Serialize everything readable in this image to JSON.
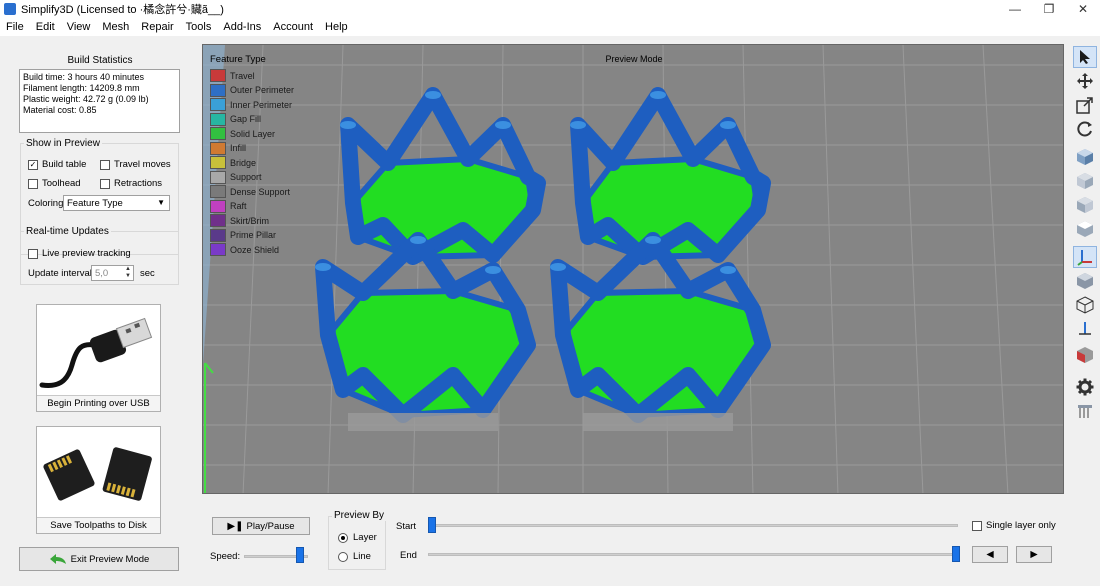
{
  "window": {
    "title": "Simplify3D (Licensed to ·橘念許兮·贜ã__)",
    "minimize": "—",
    "maximize": "❐",
    "close": "✕"
  },
  "menu": [
    "File",
    "Edit",
    "View",
    "Mesh",
    "Repair",
    "Tools",
    "Add-Ins",
    "Account",
    "Help"
  ],
  "left": {
    "stats_title": "Build Statistics",
    "stats": [
      "Build time: 3 hours 40 minutes",
      "Filament length: 14209.8 mm",
      "Plastic weight: 42.72 g (0.09 lb)",
      "Material cost: 0.85"
    ],
    "show_title": "Show in Preview",
    "build_table": "Build table",
    "travel_moves": "Travel moves",
    "toolhead": "Toolhead",
    "retractions": "Retractions",
    "coloring_label": "Coloring",
    "coloring_value": "Feature Type",
    "rt_title": "Real-time Updates",
    "live_preview": "Live preview tracking",
    "update_interval": "Update interval",
    "interval_value": "5,0",
    "sec": "sec",
    "usb_caption": "Begin Printing over USB",
    "disk_caption": "Save Toolpaths to Disk",
    "exit_label": "Exit Preview Mode"
  },
  "viewport": {
    "mode": "Preview Mode",
    "legend_title": "Feature Type",
    "legend": [
      {
        "name": "Travel",
        "color": "#c83a3a"
      },
      {
        "name": "Outer Perimeter",
        "color": "#2f6fc4"
      },
      {
        "name": "Inner Perimeter",
        "color": "#3aa0d8"
      },
      {
        "name": "Gap Fill",
        "color": "#27b6a2"
      },
      {
        "name": "Solid Layer",
        "color": "#32c040"
      },
      {
        "name": "Infill",
        "color": "#d07a32"
      },
      {
        "name": "Bridge",
        "color": "#c8c03a"
      },
      {
        "name": "Support",
        "color": "#a8a8a8"
      },
      {
        "name": "Dense Support",
        "color": "#7a7a7a"
      },
      {
        "name": "Raft",
        "color": "#c040c0"
      },
      {
        "name": "Skirt/Brim",
        "color": "#70308a"
      },
      {
        "name": "Prime Pillar",
        "color": "#5a3a8a"
      },
      {
        "name": "Ooze Shield",
        "color": "#7a3ac8"
      }
    ]
  },
  "bottom": {
    "play_pause": "Play/Pause",
    "speed": "Speed:",
    "preview_by": "Preview By",
    "layer": "Layer",
    "line": "Line",
    "start": "Start",
    "end": "End",
    "single_layer": "Single layer only",
    "prev_icon": "◀",
    "next_icon": "▶"
  },
  "colors": {
    "accent": "#1a73e8",
    "model_blue": "#2a65c8",
    "model_green": "#22dd22"
  }
}
